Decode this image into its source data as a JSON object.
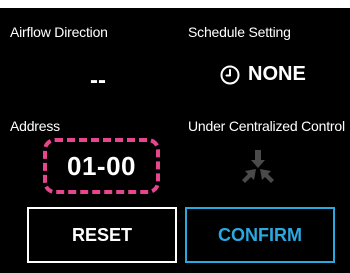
{
  "airflow": {
    "label": "Airflow Direction",
    "value": "--"
  },
  "schedule": {
    "label": "Schedule Setting",
    "value": "NONE",
    "icon": "clock-icon"
  },
  "address": {
    "label": "Address",
    "value": "01-00"
  },
  "central_control": {
    "label": "Under Centralized Control",
    "icon": "centralized-control-icon"
  },
  "buttons": {
    "reset_label": "RESET",
    "confirm_label": "CONFIRM"
  },
  "colors": {
    "background": "#000000",
    "highlight_border": "#e8458f",
    "confirm_accent": "#2aa9e0",
    "icon_dim": "#4a4a4a"
  }
}
